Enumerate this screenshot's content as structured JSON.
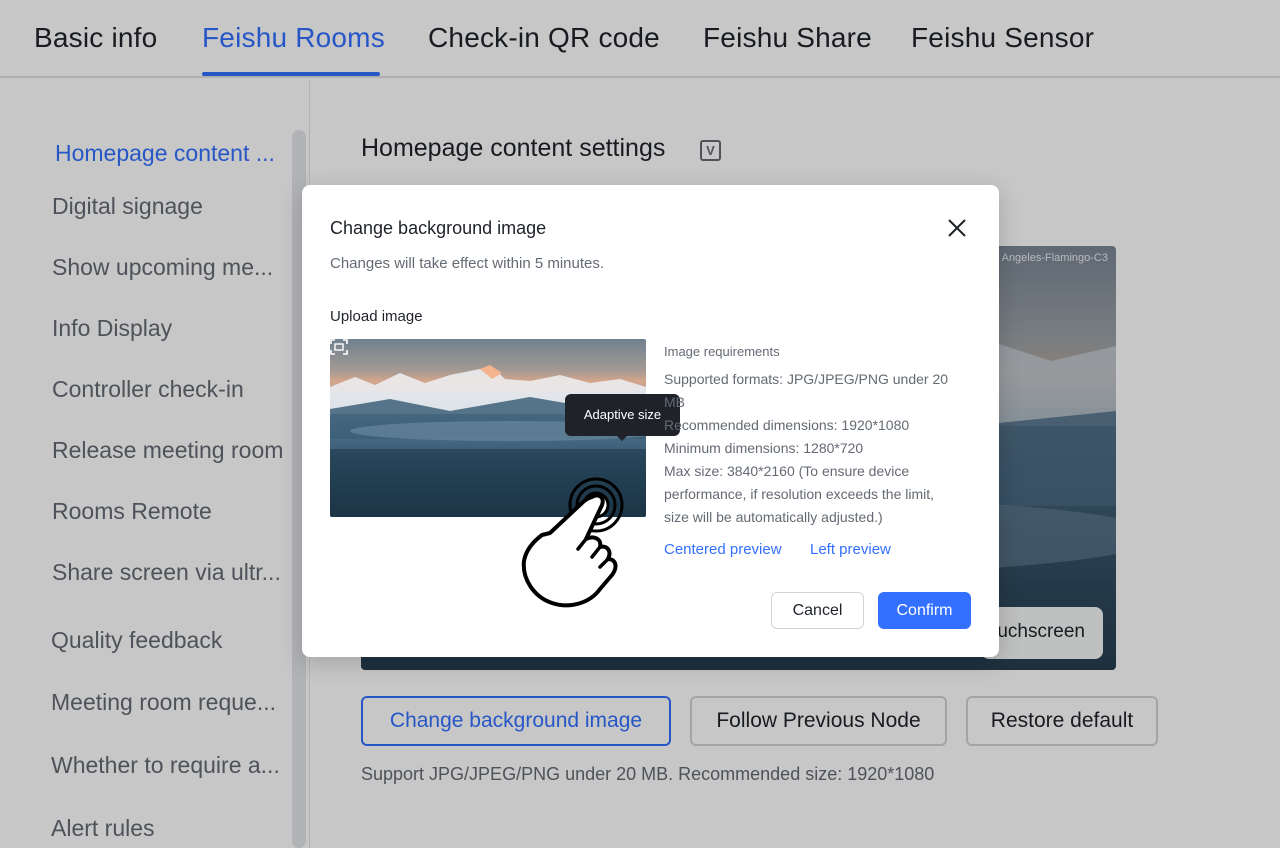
{
  "tabs": [
    {
      "label": "Basic info",
      "active": false
    },
    {
      "label": "Feishu Rooms",
      "active": true
    },
    {
      "label": "Check-in QR code",
      "active": false
    },
    {
      "label": "Feishu Share",
      "active": false
    },
    {
      "label": "Feishu Sensor",
      "active": false
    }
  ],
  "sidebar": {
    "items": [
      {
        "label": "Homepage content ...",
        "active": true
      },
      {
        "label": "Digital signage"
      },
      {
        "label": "Show upcoming me..."
      },
      {
        "label": "Info Display"
      },
      {
        "label": "Controller check-in"
      },
      {
        "label": "Release meeting room"
      },
      {
        "label": "Rooms Remote"
      },
      {
        "label": "Share screen via ultr..."
      },
      {
        "label": "Quality feedback"
      },
      {
        "label": "Meeting room reque..."
      },
      {
        "label": "Whether to require a..."
      },
      {
        "label": "Alert rules"
      }
    ]
  },
  "main": {
    "title": "Homepage content settings",
    "preview": {
      "location_text": "s Angeles-Flamingo-C3",
      "touch_button_label": "uchscreen"
    },
    "buttons": {
      "change_bg": "Change background image",
      "follow_prev": "Follow Previous Node",
      "restore": "Restore default"
    },
    "support_text": "Support JPG/JPEG/PNG under 20 MB. Recommended size: 1920*1080"
  },
  "modal": {
    "title": "Change background image",
    "subtitle": "Changes will take effect within 5 minutes.",
    "upload_label": "Upload image",
    "tooltip": "Adaptive size",
    "requirements": {
      "title": "Image requirements",
      "lines": [
        "Supported formats: JPG/JPEG/PNG under 20",
        "MB",
        "Recommended dimensions: 1920*1080",
        "Minimum dimensions: 1280*720",
        "Max size: 3840*2160 (To ensure device",
        "performance, if resolution exceeds the limit,",
        "size will be automatically adjusted.)"
      ]
    },
    "links": {
      "centered": "Centered preview",
      "left": "Left preview"
    },
    "cancel": "Cancel",
    "confirm": "Confirm"
  },
  "colors": {
    "accent": "#3370ff",
    "text": "#1f2329",
    "muted": "#646a73",
    "tooltip_bg": "#1f2329"
  },
  "icons": {
    "close": "close-icon",
    "fit": "adaptive-size-icon",
    "hand": "hand-pointer-icon",
    "title_badge": "edit-icon"
  }
}
